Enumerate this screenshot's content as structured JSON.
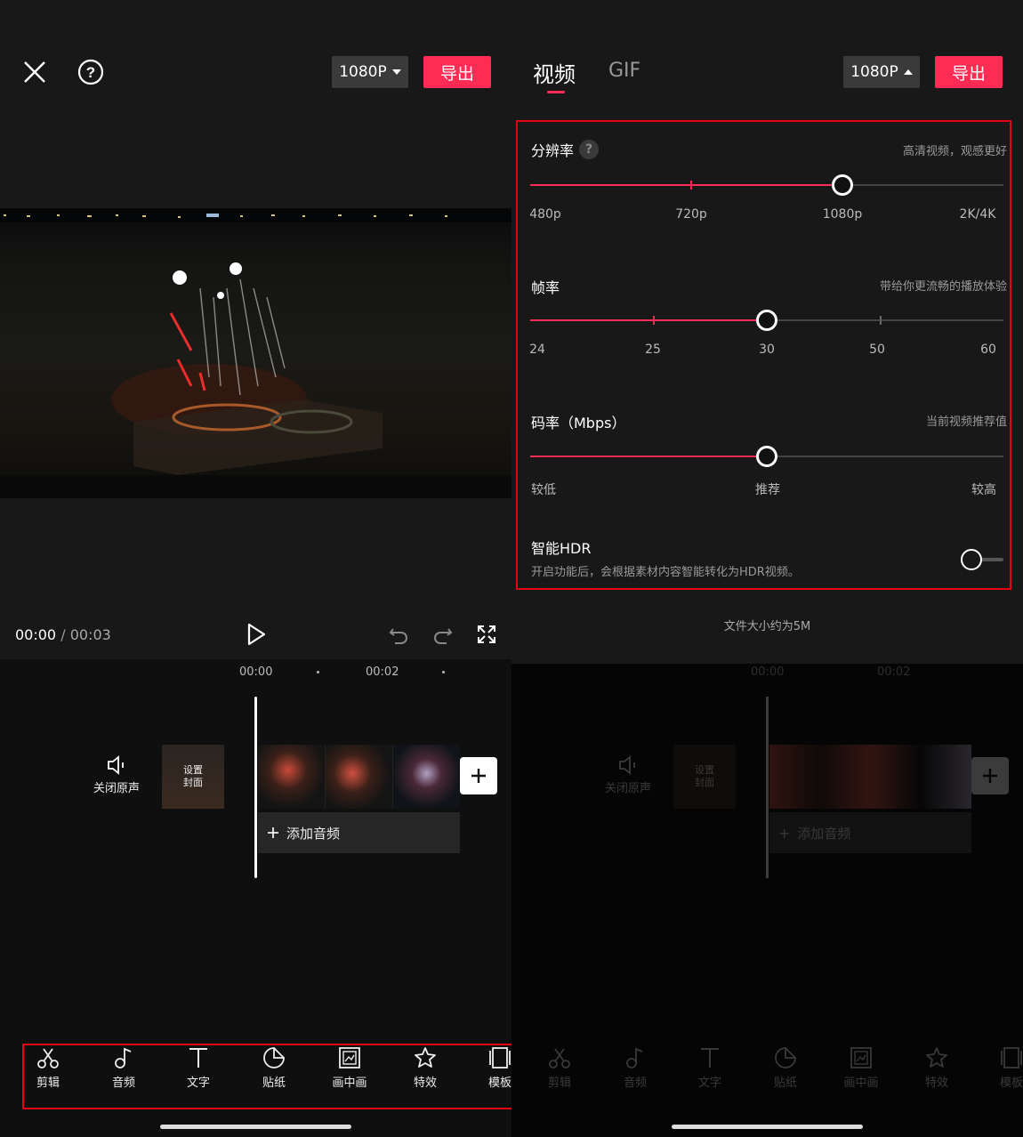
{
  "left": {
    "header": {
      "resolution_label": "1080P",
      "export_label": "导出"
    },
    "player": {
      "current_time": "00:00",
      "separator": "/",
      "total_time": "00:03"
    },
    "timeline": {
      "ruler": [
        "00:00",
        "00:02"
      ],
      "mute_label": "关闭原声",
      "cover_label": "设置封面",
      "add_audio_label": "添加音频"
    },
    "toolbar": {
      "items": [
        {
          "label": "剪辑",
          "icon": "scissors-icon"
        },
        {
          "label": "音频",
          "icon": "music-note-icon"
        },
        {
          "label": "文字",
          "icon": "text-icon"
        },
        {
          "label": "贴纸",
          "icon": "sticker-icon"
        },
        {
          "label": "画中画",
          "icon": "picture-in-picture-icon"
        },
        {
          "label": "特效",
          "icon": "effects-star-icon"
        },
        {
          "label": "模板",
          "icon": "template-icon"
        }
      ]
    }
  },
  "right": {
    "header": {
      "tabs": [
        {
          "label": "视频",
          "active": true
        },
        {
          "label": "GIF",
          "active": false
        }
      ],
      "resolution_label": "1080P",
      "export_label": "导出"
    },
    "settings": {
      "resolution": {
        "title": "分辨率",
        "hint": "高清视频，观感更好",
        "ticks": [
          "480p",
          "720p",
          "1080p",
          "2K/4K"
        ],
        "selected": "1080p"
      },
      "framerate": {
        "title": "帧率",
        "hint": "带给你更流畅的播放体验",
        "ticks": [
          "24",
          "25",
          "30",
          "50",
          "60"
        ],
        "selected": "30"
      },
      "bitrate": {
        "title": "码率（Mbps）",
        "hint": "当前视频推荐值",
        "ticks": [
          "较低",
          "推荐",
          "较高"
        ],
        "selected": "推荐"
      },
      "hdr": {
        "title": "智能HDR",
        "description": "开启功能后，会根据素材内容智能转化为HDR视频。",
        "enabled": false
      }
    },
    "file_size": "文件大小约为5M"
  },
  "colors": {
    "accent": "#fe2c55",
    "highlight_box": "#e60012",
    "background": "#181818"
  }
}
